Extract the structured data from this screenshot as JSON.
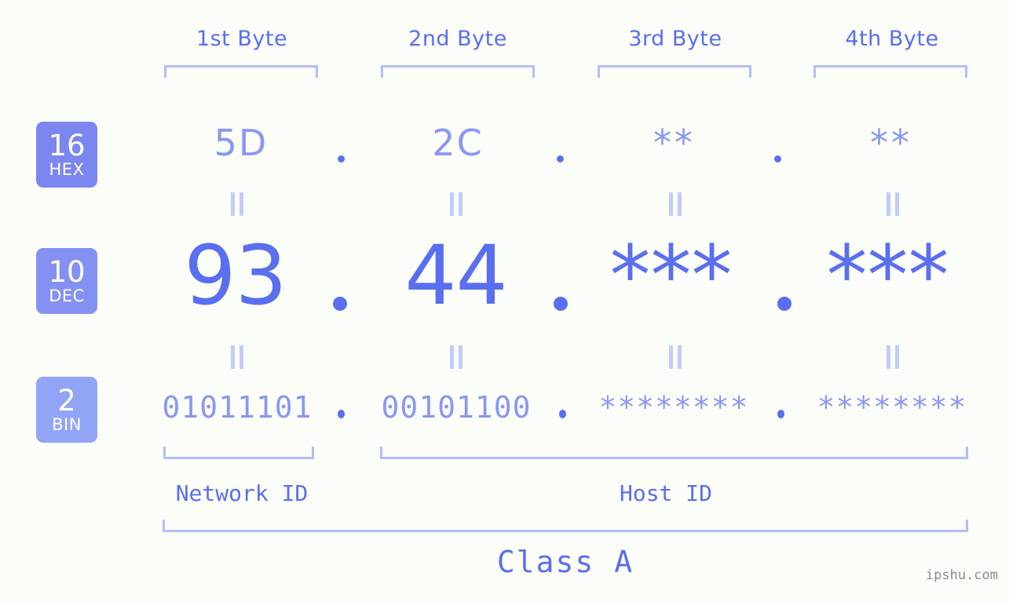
{
  "colors": {
    "background": "#fbfdf8",
    "accent_strong": "#5a6ef0",
    "accent_mid": "#8b97f2",
    "accent_light": "#b3bdfb",
    "bar_light": "#c3cbfb",
    "badge_hex": "#7b86ef",
    "badge_dec": "#8591f2",
    "badge_bin": "#92a4f6",
    "watermark": "#8c8c8c"
  },
  "header": {
    "byte_labels": [
      "1st Byte",
      "2nd Byte",
      "3rd Byte",
      "4th Byte"
    ]
  },
  "radix_badges": [
    {
      "number": "16",
      "name": "HEX"
    },
    {
      "number": "10",
      "name": "DEC"
    },
    {
      "number": "2",
      "name": "BIN"
    }
  ],
  "rows": {
    "hex": {
      "values": [
        "5D",
        "2C",
        "**",
        "**"
      ],
      "separator": "."
    },
    "dec": {
      "values": [
        "93",
        "44",
        "***",
        "***"
      ],
      "separator": "."
    },
    "bin": {
      "values": [
        "01011101",
        "00101100",
        "********",
        "********"
      ],
      "separator": "."
    }
  },
  "equality_mark": "‖",
  "footer": {
    "network_id_label": "Network ID",
    "host_id_label": "Host ID",
    "class_label": "Class A"
  },
  "watermark": "ipshu.com"
}
